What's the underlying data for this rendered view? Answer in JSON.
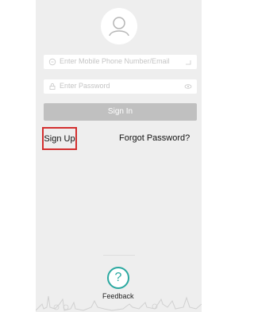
{
  "login": {
    "phone_placeholder": "Enter Mobile Phone Number/Email",
    "password_placeholder": "Enter Password",
    "signin_label": "Sign In",
    "signup_label": "Sign Up",
    "forgot_label": "Forgot Password?"
  },
  "footer": {
    "feedback_label": "Feedback",
    "feedback_icon_glyph": "?"
  },
  "icons": {
    "avatar": "user-avatar-icon",
    "phone": "phone-icon",
    "lock": "lock-icon",
    "eye": "eye-icon",
    "clear": "clear-icon",
    "feedback": "question-icon"
  },
  "colors": {
    "panel_bg": "#eeeeee",
    "signin_bg": "#c0c0c0",
    "signup_highlight": "#d32f2f",
    "feedback_accent": "#2aa8a0"
  }
}
